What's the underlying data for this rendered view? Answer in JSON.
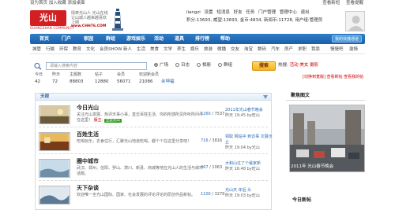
{
  "topbar": {
    "left": "设为首页  加入收藏  添加桌面",
    "right": [
      "查看新短",
      "查看提醒"
    ]
  },
  "header": {
    "logo_text": "光山",
    "logo_sub": "GUANGSHAN COMMUNITY",
    "slogan": "情牵光山人 光山在线 让山城人越来越喜欢上网",
    "url_text": "www.CHH76.COM",
    "user": {
      "name": "liangzi",
      "links": [
        "设置",
        "短消息",
        "好友",
        "任务",
        "门户管理",
        "管理中心",
        "退出"
      ],
      "stats_line": "积分:13693, 威望:13693, 金币:4834, 新闻币:11728, 用户组:管理员"
    }
  },
  "nav": {
    "items": [
      "首页",
      "门户",
      "家园",
      "群组",
      "游戏娱乐",
      "活动",
      "道具",
      "排行榜",
      "帮助"
    ],
    "my_zone": "我的快捷通道"
  },
  "subnav": {
    "items": [
      "城管",
      "行摄",
      "环保",
      "教育",
      "文化",
      "会员SHOW",
      "新人",
      "生活",
      "美食",
      "文学",
      "养生",
      "娱乐",
      "旅游",
      "微播",
      "交友",
      "淘宝",
      "数码",
      "汽车",
      "房产",
      "求职",
      "我靠",
      "慢慢吧",
      "激情"
    ]
  },
  "search": {
    "placeholder": "请输入搜索内容",
    "options": [
      "广场",
      "日志",
      "相册",
      "群组",
      "论坛"
    ],
    "selected": "广场",
    "button": "搜索",
    "hotwords_label": "热搜:",
    "hotwords": [
      "活动",
      "美女",
      "摄影"
    ]
  },
  "stats": {
    "labels": [
      "今日",
      "昨日",
      "主题数",
      "帖子",
      "会员",
      "欢迎新会员"
    ],
    "values": [
      "42",
      "72",
      "88803",
      "12880",
      "56071",
      "21086",
      "余坤福"
    ]
  },
  "links2": "[切换到宽版]  查看新帖  查看我的帖",
  "panel": {
    "title": "天视",
    "forums": [
      {
        "name": "今日光山",
        "desc": "关注光山发展、热评天事小事，直击百姓生活、你的所感所见所听所问尽在这里！",
        "mod_label": "版主:",
        "mod": "全是光山",
        "count": "1260",
        "count2": "7537",
        "last_title": "2011年光山春节晚会",
        "last_time": "昨天 19:45 by旺山"
      },
      {
        "name": "百姓生活",
        "desc": "吃喝玩乐，衣食住行，汇聚光山地道吃喝，都个个在这里分享吧！",
        "count": "716",
        "count2": "3816",
        "last_title": "领取 网站中 到访事 次展示止",
        "last_time": "昨天 19:04 by光山"
      },
      {
        "name": "圈中城市",
        "desc": "武汉、郑州、信阳、罗山、潢川、新县、商城等地在光山人的生活与城市话题。",
        "count": "467",
        "count2": "1063",
        "last_title": "大和山过了个最家新",
        "last_time": "昨天 16:48 by旺山"
      },
      {
        "name": "天下杂谈",
        "desc": "欢迎唯一全光山国际、国家、社会发展的评论评论的原创作品新帖。",
        "count": "1100",
        "count2": "3279",
        "last_title": "光山天 年后 头",
        "last_time": "昨天 19:03 by旺山"
      }
    ]
  },
  "sidebar": {
    "featured_title": "聚焦图文",
    "image_caption": "2011年 光山春节晚会",
    "news_title": "今日新帖"
  }
}
